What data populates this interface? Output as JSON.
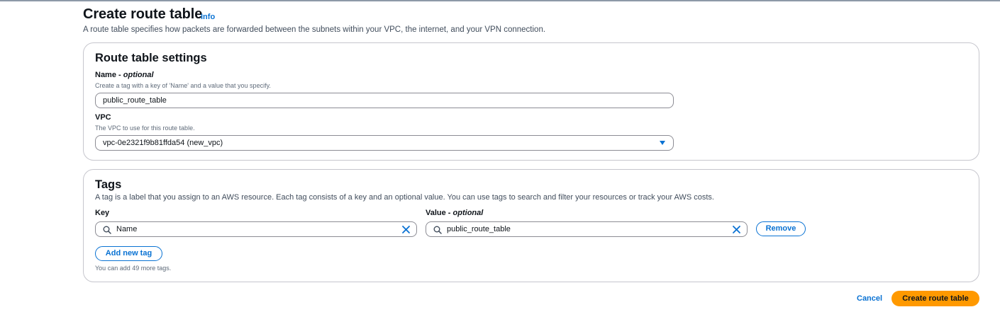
{
  "header": {
    "title": "Create route table",
    "info_link": "Info",
    "description": "A route table specifies how packets are forwarded between the subnets within your VPC, the internet, and your VPN connection."
  },
  "settings": {
    "title": "Route table settings",
    "name_label": "Name - ",
    "name_label_suffix": "optional",
    "name_hint": "Create a tag with a key of 'Name' and a value that you specify.",
    "name_value": "public_route_table",
    "vpc_label": "VPC",
    "vpc_hint": "The VPC to use for this route table.",
    "vpc_value": "vpc-0e2321f9b81ffda54 (new_vpc)"
  },
  "tags": {
    "title": "Tags",
    "description": "A tag is a label that you assign to an AWS resource. Each tag consists of a key and an optional value. You can use tags to search and filter your resources or track your AWS costs.",
    "key_label": "Key",
    "value_label": "Value - ",
    "value_label_suffix": "optional",
    "key_value": "Name",
    "value_value": "public_route_table",
    "remove_label": "Remove",
    "add_label": "Add new tag",
    "remaining_hint": "You can add 49 more tags."
  },
  "footer": {
    "cancel_label": "Cancel",
    "submit_label": "Create route table"
  },
  "icons": {
    "search": "search-icon",
    "clear": "close-icon",
    "dropdown": "caret-down-icon"
  },
  "colors": {
    "accent": "#0972d3",
    "primary_button": "#ff9900",
    "border": "#c6c6cd"
  }
}
